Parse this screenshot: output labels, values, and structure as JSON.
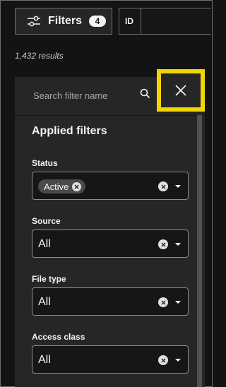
{
  "toolbar": {
    "filters_label": "Filters",
    "filters_count": "4",
    "id_label": "ID"
  },
  "results": "1,432 results",
  "panel": {
    "search_placeholder": "Search filter name",
    "applied_title": "Applied filters",
    "filters": [
      {
        "label": "Status",
        "chip": "Active"
      },
      {
        "label": "Source",
        "value": "All"
      },
      {
        "label": "File type",
        "value": "All"
      },
      {
        "label": "Access class",
        "value": "All"
      }
    ]
  },
  "icons": {
    "filters": "sliders-icon",
    "search": "search-icon",
    "close": "close-icon",
    "clear": "clear-icon",
    "dropdown": "chevron-down-icon"
  },
  "colors": {
    "background": "#131313",
    "panel": "#262626",
    "field": "#161616",
    "highlight": "#f1d600",
    "chip": "#4a4a4a"
  }
}
